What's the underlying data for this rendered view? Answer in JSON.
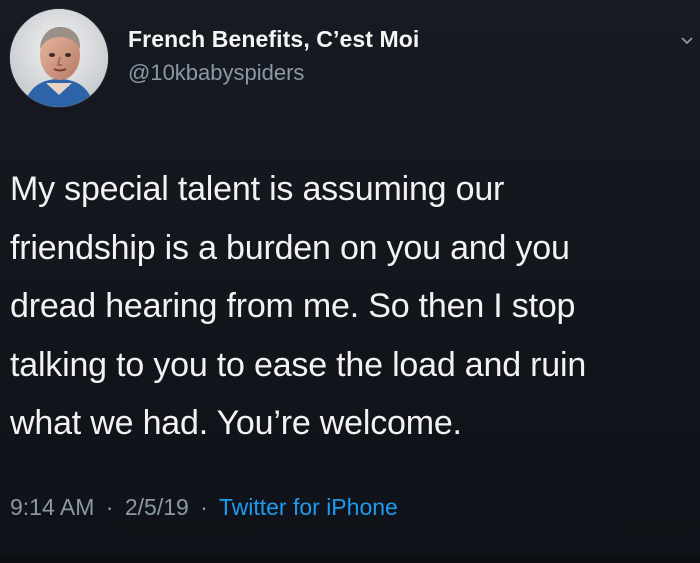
{
  "tweet": {
    "display_name": "French Benefits, C’est Moi",
    "handle": "@10kbabyspiders",
    "text_lines": [
      "My special talent is assuming our",
      "friendship is a burden on you and you",
      "dread hearing from me.  So then I stop",
      "talking to you to ease the load and ruin",
      "what we had.  You’re welcome."
    ],
    "time": "9:14 AM",
    "date": "2/5/19",
    "separator": "·",
    "source": "Twitter for iPhone"
  },
  "icons": {
    "avatar": "profile-photo",
    "menu": "chevron-down-icon"
  },
  "colors": {
    "background": "#14171f",
    "text": "#f2f2f2",
    "muted": "#8b98a5",
    "link": "#1d9bf0"
  }
}
